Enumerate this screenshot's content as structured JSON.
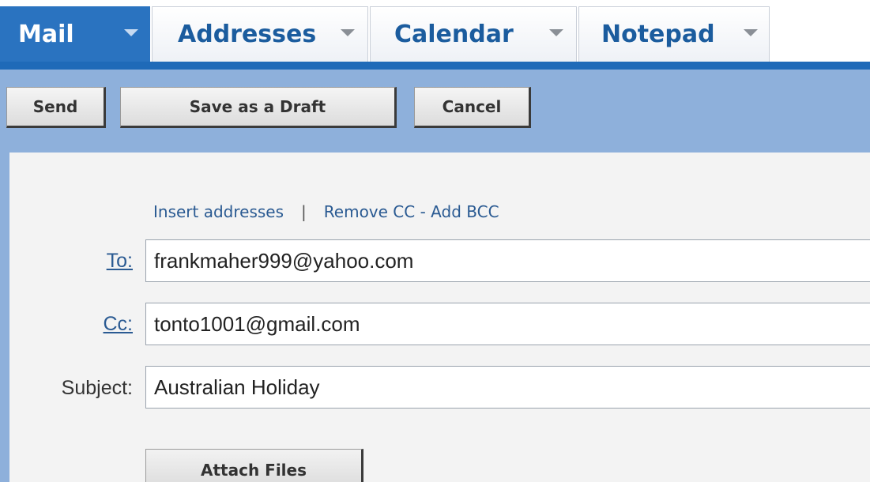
{
  "tabs": [
    {
      "label": "Mail",
      "active": true
    },
    {
      "label": "Addresses",
      "active": false
    },
    {
      "label": "Calendar",
      "active": false
    },
    {
      "label": "Notepad",
      "active": false
    }
  ],
  "toolbar": {
    "send_label": "Send",
    "save_draft_label": "Save as a Draft",
    "cancel_label": "Cancel"
  },
  "compose": {
    "links": {
      "insert_addresses": "Insert addresses",
      "separator": "|",
      "cc_bcc": "Remove CC - Add BCC"
    },
    "to_label": "To:",
    "to_value": "frankmaher999@yahoo.com",
    "cc_label": "Cc:",
    "cc_value": "tonto1001@gmail.com",
    "subject_label": "Subject:",
    "subject_value": "Australian Holiday",
    "attach_label": "Attach Files"
  },
  "colors": {
    "tab_active": "#2a73c0",
    "toolbar": "#8eb0db",
    "link": "#2a5a92"
  }
}
